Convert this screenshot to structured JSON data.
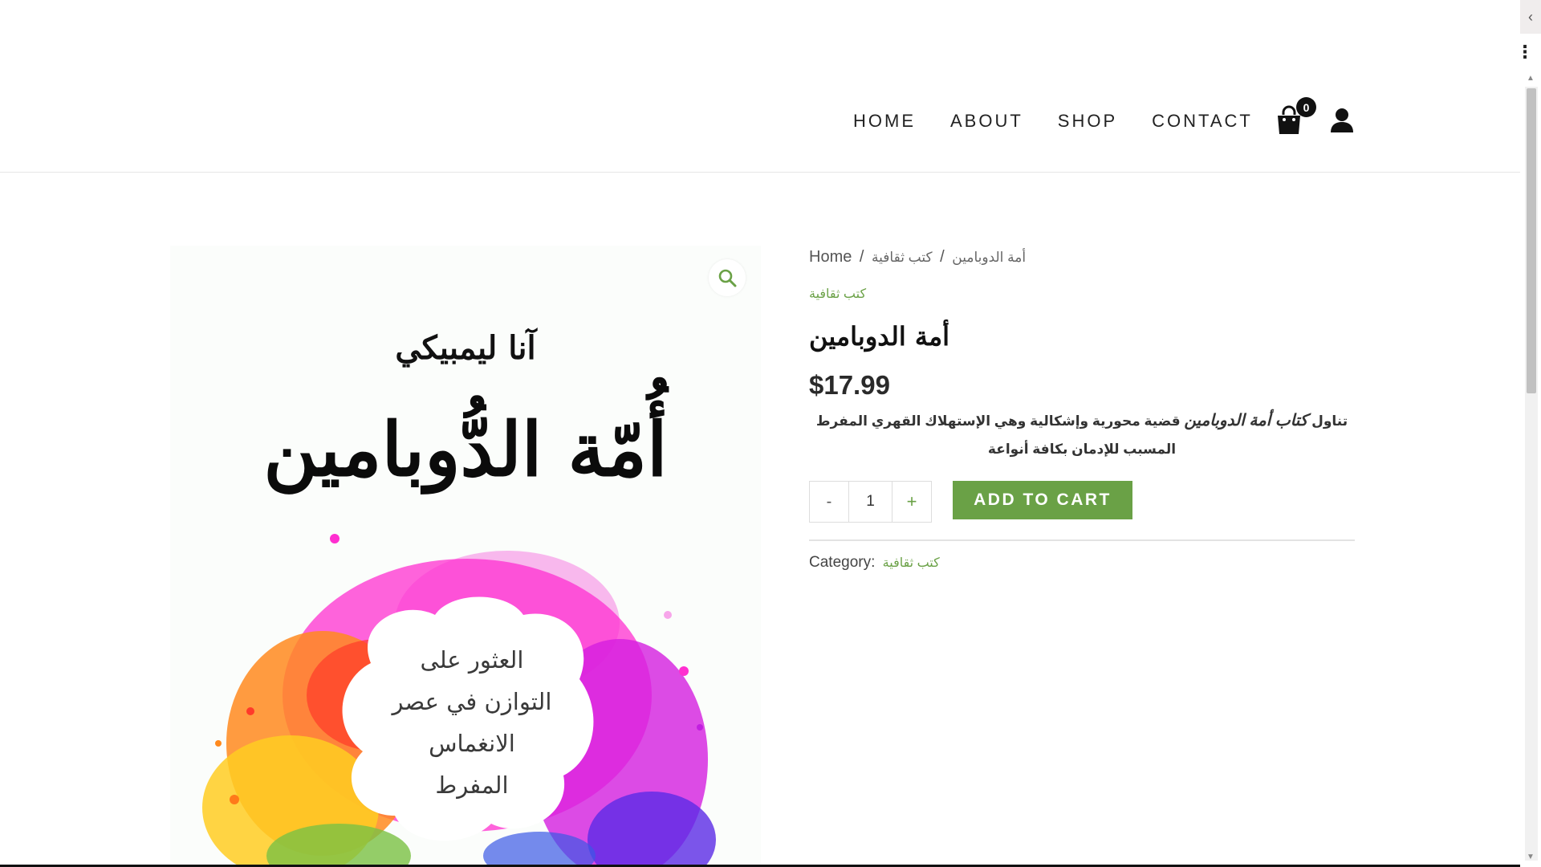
{
  "nav": {
    "items": [
      "HOME",
      "ABOUT",
      "SHOP",
      "CONTACT"
    ],
    "cart_count": "0"
  },
  "icons": {
    "cart": "shopping-bag-icon",
    "account": "user-icon",
    "zoom": "magnifier-icon",
    "scroll_up": "chevron-left-icon",
    "menu": "kebab-menu-icon"
  },
  "breadcrumb": {
    "home": "Home",
    "sep1": "/",
    "product": "أمة الدوبامين",
    "sep2": "/",
    "category": "كتب ثقافية"
  },
  "product": {
    "category_top": "كتب ثقافية",
    "title": "أمة الدوبامين",
    "price": "$17.99",
    "desc_prefix": "تناول ",
    "desc_emphasis": "كتاب أمة الدوبامين",
    "desc_rest": " قضية محورية وإشكالية وهي الإستهلاك القهري المفرط المسبب للإدمان بكافة أنواعة",
    "quantity": "1",
    "minus_label": "-",
    "plus_label": "+",
    "add_to_cart": "ADD TO CART",
    "category_label": "Category:",
    "category_link": "كتب ثقافية"
  },
  "cover": {
    "author": "آنا ليمبيكي",
    "title": "أُمّة الدُّوبامين",
    "subtitle_lines": [
      "العثور على",
      "التوازن في عصر",
      "الانغماس",
      "المفرط"
    ]
  },
  "colors": {
    "accent": "#6aa146",
    "text": "#222222",
    "badge": "#111111"
  }
}
